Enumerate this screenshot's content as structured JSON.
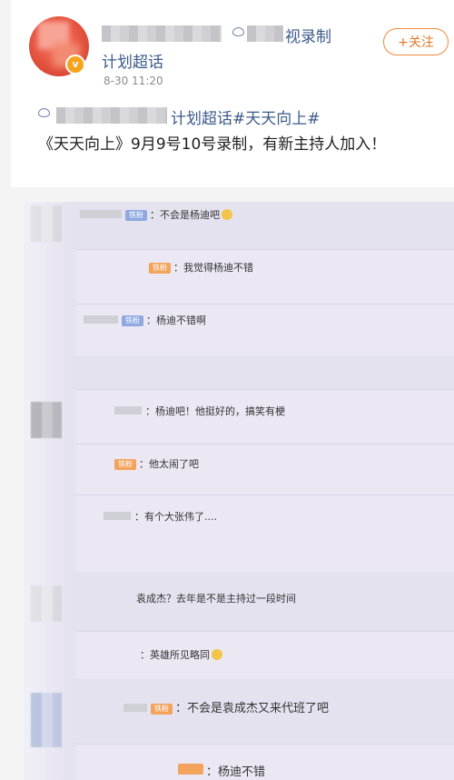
{
  "post": {
    "author_name_visible": "视录制",
    "author_name_line2": "计划超话",
    "time": "8-30 11:20",
    "follow_label": "+关注",
    "tag_visible": "计划超话#天天向上#",
    "text": "《天天向上》9月9号10号录制，有新主持人加入！"
  },
  "chat": {
    "messages": [
      {
        "badge": "铁粉",
        "text": "：不会是杨迪吧"
      },
      {
        "badge": "铁粉",
        "text": "：我觉得杨迪不错"
      },
      {
        "badge": "铁粉",
        "text": "：杨迪不错啊"
      },
      {
        "badge": "",
        "text": "：杨迪吧！他挺好的，搞笑有梗"
      },
      {
        "badge": "铁粉",
        "text": "：他太闹了吧"
      },
      {
        "badge": "",
        "text": "：有个大张伟了...."
      },
      {
        "badge": "",
        "text": "袁成杰？去年是不是主持过一段时间"
      },
      {
        "badge": "",
        "text": "：英雄所见略同"
      },
      {
        "badge": "铁粉",
        "text": "：不会是袁成杰又来代班了吧"
      },
      {
        "badge": "",
        "text": "：杨迪不错"
      }
    ]
  }
}
